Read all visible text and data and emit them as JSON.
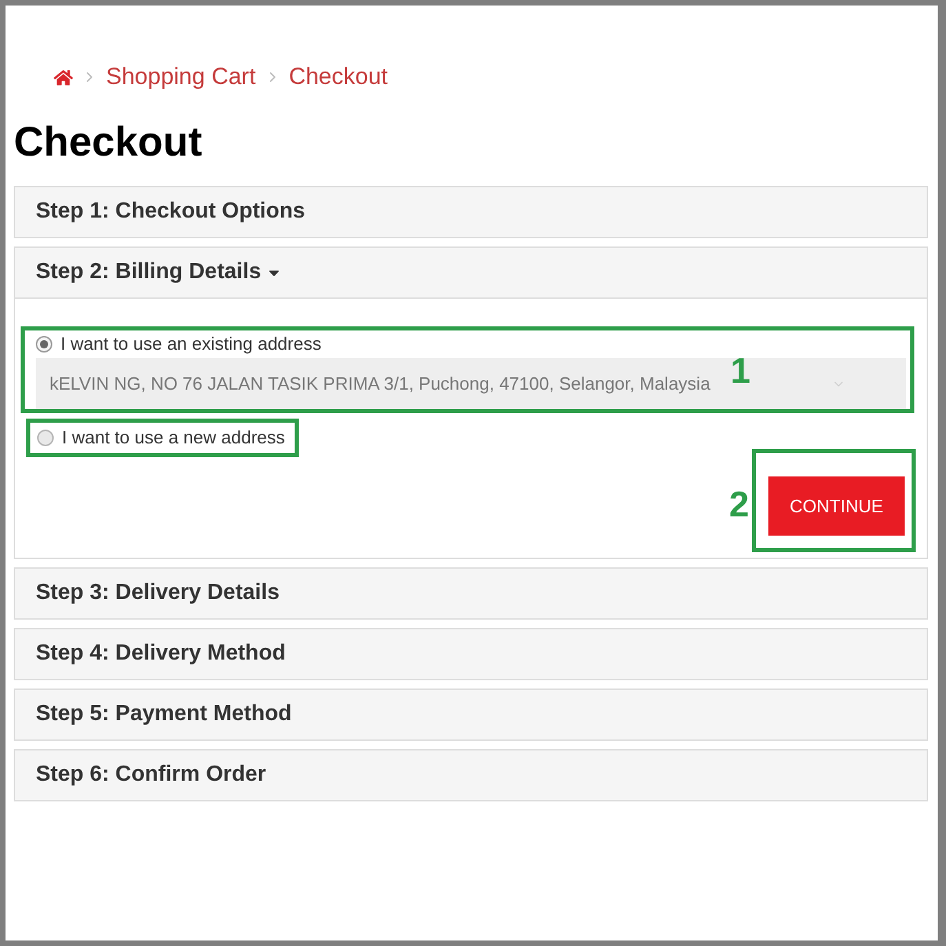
{
  "breadcrumb": {
    "items": [
      {
        "label": "Shopping Cart"
      },
      {
        "label": "Checkout"
      }
    ]
  },
  "title": "Checkout",
  "steps": [
    {
      "label": "Step 1: Checkout Options",
      "expanded": false
    },
    {
      "label": "Step 2: Billing Details",
      "expanded": true,
      "billing": {
        "options": [
          {
            "label": "I want to use an existing address",
            "selected": true
          },
          {
            "label": "I want to use a new address",
            "selected": false
          }
        ],
        "address_select": {
          "value": "kELVIN NG, NO 76 JALAN TASIK PRIMA 3/1, Puchong, 47100, Selangor, Malaysia"
        },
        "continue_button": "CONTINUE"
      }
    },
    {
      "label": "Step 3: Delivery Details",
      "expanded": false
    },
    {
      "label": "Step 4: Delivery Method",
      "expanded": false
    },
    {
      "label": "Step 5: Payment Method",
      "expanded": false
    },
    {
      "label": "Step 6: Confirm Order",
      "expanded": false
    }
  ],
  "annotations": [
    {
      "label": "1"
    },
    {
      "label": "2"
    }
  ]
}
